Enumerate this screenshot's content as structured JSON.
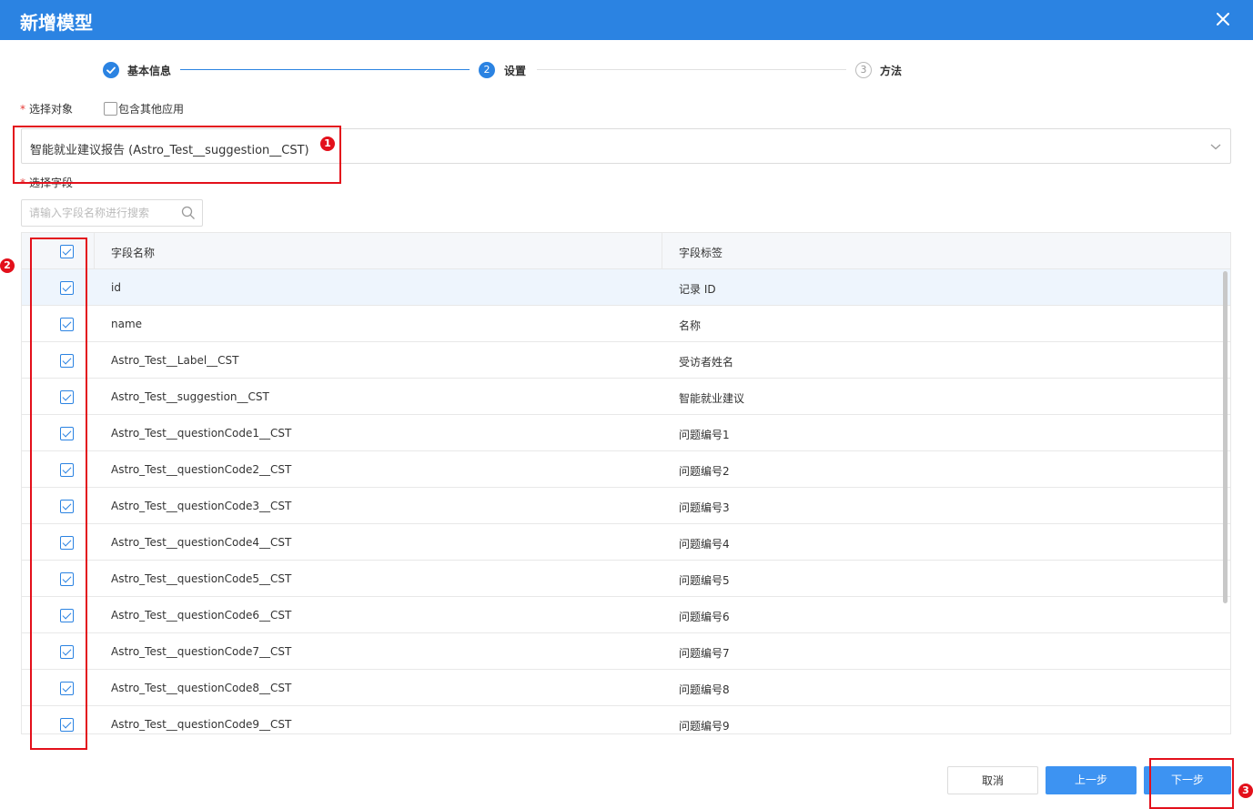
{
  "dialog": {
    "title": "新增模型"
  },
  "steps": [
    {
      "label": "基本信息",
      "status": "done",
      "number": ""
    },
    {
      "label": "设置",
      "status": "active",
      "number": "2"
    },
    {
      "label": "方法",
      "status": "pending",
      "number": "3"
    }
  ],
  "object_select": {
    "label": "选择对象",
    "include_other_label": "包含其他应用",
    "include_other_checked": false,
    "value": "智能就业建议报告 (Astro_Test__suggestion__CST)"
  },
  "fields": {
    "label": "选择字段",
    "search_placeholder": "请输入字段名称进行搜索",
    "columns": {
      "name": "字段名称",
      "label": "字段标签"
    },
    "all_checked": true,
    "rows": [
      {
        "name": "id",
        "label": "记录 ID",
        "checked": true
      },
      {
        "name": "name",
        "label": "名称",
        "checked": true
      },
      {
        "name": "Astro_Test__Label__CST",
        "label": "受访者姓名",
        "checked": true
      },
      {
        "name": "Astro_Test__suggestion__CST",
        "label": "智能就业建议",
        "checked": true
      },
      {
        "name": "Astro_Test__questionCode1__CST",
        "label": "问题编号1",
        "checked": true
      },
      {
        "name": "Astro_Test__questionCode2__CST",
        "label": "问题编号2",
        "checked": true
      },
      {
        "name": "Astro_Test__questionCode3__CST",
        "label": "问题编号3",
        "checked": true
      },
      {
        "name": "Astro_Test__questionCode4__CST",
        "label": "问题编号4",
        "checked": true
      },
      {
        "name": "Astro_Test__questionCode5__CST",
        "label": "问题编号5",
        "checked": true
      },
      {
        "name": "Astro_Test__questionCode6__CST",
        "label": "问题编号6",
        "checked": true
      },
      {
        "name": "Astro_Test__questionCode7__CST",
        "label": "问题编号7",
        "checked": true
      },
      {
        "name": "Astro_Test__questionCode8__CST",
        "label": "问题编号8",
        "checked": true
      },
      {
        "name": "Astro_Test__questionCode9__CST",
        "label": "问题编号9",
        "checked": true
      }
    ]
  },
  "footer": {
    "cancel": "取消",
    "prev": "上一步",
    "next": "下一步"
  },
  "annotations": [
    {
      "number": "1"
    },
    {
      "number": "2"
    },
    {
      "number": "3"
    }
  ],
  "colors": {
    "primary": "#2b83e2",
    "button": "#3d93f2",
    "annotation": "#e3101b"
  }
}
